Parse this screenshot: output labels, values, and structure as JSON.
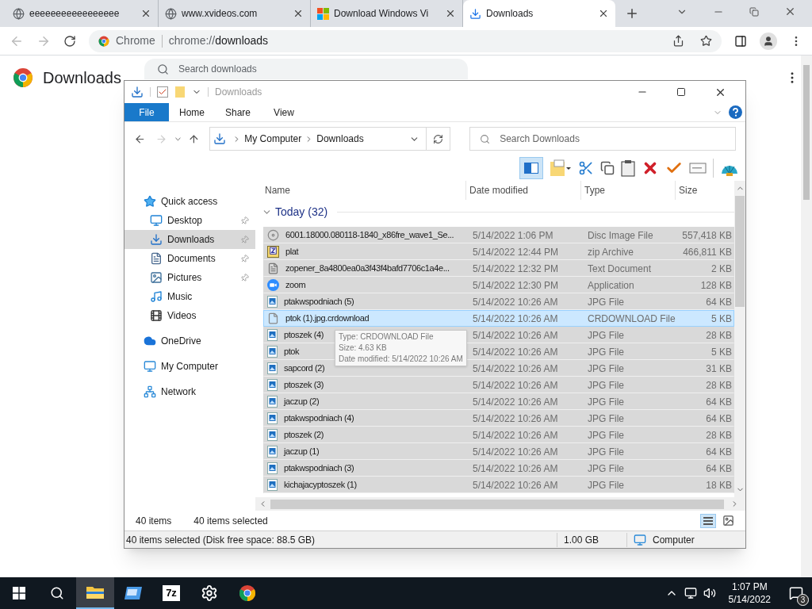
{
  "browser": {
    "tabs": [
      {
        "title": "eeeeeeeeeeeeeeeee",
        "kind": "globe",
        "selected": false
      },
      {
        "title": "www.xvideos.com",
        "kind": "globe",
        "selected": false
      },
      {
        "title": "Download Windows Vi",
        "kind": "windows",
        "selected": false
      },
      {
        "title": "Downloads",
        "kind": "download",
        "selected": true
      }
    ],
    "omnibox": {
      "chip": "Chrome",
      "url_prefix": "chrome://",
      "url_path": "downloads"
    },
    "page": {
      "heading": "Downloads",
      "search_placeholder": "Search downloads"
    }
  },
  "explorer": {
    "title": "Downloads",
    "ribbon_tabs": [
      {
        "label": "File",
        "selected": true
      },
      {
        "label": "Home",
        "selected": false
      },
      {
        "label": "Share",
        "selected": false
      },
      {
        "label": "View",
        "selected": false
      }
    ],
    "breadcrumb": [
      "My Computer",
      "Downloads"
    ],
    "search_placeholder": "Search Downloads",
    "sidebar": [
      {
        "label": "Quick access",
        "kind": "star",
        "selected": false,
        "children": [
          {
            "label": "Desktop",
            "kind": "desktop",
            "pinned": true,
            "selected": false
          },
          {
            "label": "Downloads",
            "kind": "download",
            "pinned": true,
            "selected": true
          },
          {
            "label": "Documents",
            "kind": "document",
            "pinned": true,
            "selected": false
          },
          {
            "label": "Pictures",
            "kind": "pictures",
            "pinned": true,
            "selected": false
          },
          {
            "label": "Music",
            "kind": "music",
            "pinned": false,
            "selected": false
          },
          {
            "label": "Videos",
            "kind": "videos",
            "pinned": false,
            "selected": false
          }
        ]
      },
      {
        "label": "OneDrive",
        "kind": "cloud",
        "selected": false
      },
      {
        "label": "My Computer",
        "kind": "computer",
        "selected": false
      },
      {
        "label": "Network",
        "kind": "network",
        "selected": false
      }
    ],
    "columns": [
      "Name",
      "Date modified",
      "Type",
      "Size"
    ],
    "group": {
      "label": "Today (32)",
      "expanded": true
    },
    "rows": [
      {
        "name": "6001.18000.080118-1840_x86fre_wave1_Se...",
        "date": "5/14/2022 1:06 PM",
        "type": "Disc Image File",
        "size": "557,418 KB",
        "kind": "disc",
        "selected": true,
        "hovered": false
      },
      {
        "name": "plat",
        "date": "5/14/2022 12:44 PM",
        "type": "zip Archive",
        "size": "466,811 KB",
        "kind": "zip",
        "selected": true,
        "hovered": false
      },
      {
        "name": "zopener_8a4800ea0a3f43f4bafd7706c1a4e...",
        "date": "5/14/2022 12:32 PM",
        "type": "Text Document",
        "size": "2 KB",
        "kind": "text",
        "selected": true,
        "hovered": false
      },
      {
        "name": "zoom",
        "date": "5/14/2022 12:30 PM",
        "type": "Application",
        "size": "128 KB",
        "kind": "app",
        "selected": true,
        "hovered": false
      },
      {
        "name": "ptakwspodniach (5)",
        "date": "5/14/2022 10:26 AM",
        "type": "JPG File",
        "size": "64 KB",
        "kind": "image",
        "selected": true,
        "hovered": false
      },
      {
        "name": "ptok (1).jpg.crdownload",
        "date": "5/14/2022 10:26 AM",
        "type": "CRDOWNLOAD File",
        "size": "5 KB",
        "kind": "blank",
        "selected": true,
        "hovered": true
      },
      {
        "name": "ptoszek (4)",
        "date": "5/14/2022 10:26 AM",
        "type": "JPG File",
        "size": "28 KB",
        "kind": "image",
        "selected": true,
        "hovered": false
      },
      {
        "name": "ptok",
        "date": "5/14/2022 10:26 AM",
        "type": "JPG File",
        "size": "5 KB",
        "kind": "image",
        "selected": true,
        "hovered": false
      },
      {
        "name": "sapcord (2)",
        "date": "5/14/2022 10:26 AM",
        "type": "JPG File",
        "size": "31 KB",
        "kind": "image",
        "selected": true,
        "hovered": false
      },
      {
        "name": "ptoszek (3)",
        "date": "5/14/2022 10:26 AM",
        "type": "JPG File",
        "size": "28 KB",
        "kind": "image",
        "selected": true,
        "hovered": false
      },
      {
        "name": "jaczup (2)",
        "date": "5/14/2022 10:26 AM",
        "type": "JPG File",
        "size": "64 KB",
        "kind": "image",
        "selected": true,
        "hovered": false
      },
      {
        "name": "ptakwspodniach (4)",
        "date": "5/14/2022 10:26 AM",
        "type": "JPG File",
        "size": "64 KB",
        "kind": "image",
        "selected": true,
        "hovered": false
      },
      {
        "name": "ptoszek (2)",
        "date": "5/14/2022 10:26 AM",
        "type": "JPG File",
        "size": "28 KB",
        "kind": "image",
        "selected": true,
        "hovered": false
      },
      {
        "name": "jaczup (1)",
        "date": "5/14/2022 10:26 AM",
        "type": "JPG File",
        "size": "64 KB",
        "kind": "image",
        "selected": true,
        "hovered": false
      },
      {
        "name": "ptakwspodniach (3)",
        "date": "5/14/2022 10:26 AM",
        "type": "JPG File",
        "size": "64 KB",
        "kind": "image",
        "selected": true,
        "hovered": false
      },
      {
        "name": "kichajacyptoszek (1)",
        "date": "5/14/2022 10:26 AM",
        "type": "JPG File",
        "size": "18 KB",
        "kind": "image",
        "selected": true,
        "hovered": false
      }
    ],
    "tooltip": [
      "Type: CRDOWNLOAD File",
      "Size: 4.63 KB",
      "Date modified: 5/14/2022 10:26 AM"
    ],
    "item_count": "40 items",
    "selected_count": "40 items selected",
    "status_bar": {
      "left": "40 items selected (Disk free space: 88.5 GB)",
      "size": "1.00 GB",
      "location": "Computer"
    }
  },
  "taskbar": {
    "apps": [
      {
        "kind": "explorer",
        "active": true
      },
      {
        "kind": "remote",
        "active": false
      },
      {
        "kind": "archiver",
        "label": "7z",
        "active": false
      },
      {
        "kind": "settings",
        "active": false
      },
      {
        "kind": "chrome",
        "active": false
      }
    ],
    "time": "1:07 PM",
    "date": "5/14/2022",
    "notifications": "3"
  }
}
